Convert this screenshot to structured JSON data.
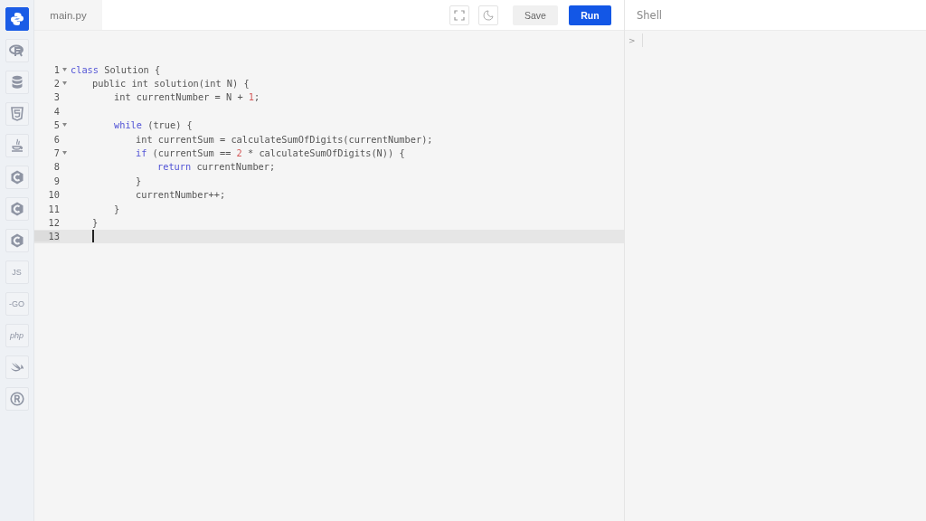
{
  "sidebar": {
    "items": [
      {
        "kind": "python",
        "selected": true
      },
      {
        "kind": "r",
        "selected": false
      },
      {
        "kind": "database",
        "selected": false
      },
      {
        "kind": "html",
        "selected": false
      },
      {
        "kind": "java",
        "selected": false
      },
      {
        "kind": "c",
        "selected": false
      },
      {
        "kind": "c",
        "selected": false
      },
      {
        "kind": "c",
        "selected": false
      },
      {
        "kind": "text",
        "label": "JS",
        "selected": false
      },
      {
        "kind": "text",
        "label": "-GO",
        "selected": false
      },
      {
        "kind": "text",
        "label": "php",
        "italic": true,
        "selected": false
      },
      {
        "kind": "swift",
        "selected": false
      },
      {
        "kind": "registered",
        "selected": false
      }
    ]
  },
  "editor": {
    "tab": "main.py",
    "buttons": {
      "save": "Save",
      "run": "Run"
    },
    "lines": [
      {
        "number": "1",
        "foldable": true,
        "active": false,
        "tokens": [
          {
            "kind": "keyword",
            "text": "class"
          },
          {
            "kind": "plain",
            "text": " Solution {"
          }
        ]
      },
      {
        "number": "2",
        "foldable": true,
        "active": false,
        "tokens": [
          {
            "kind": "plain",
            "text": "public int solution(int N) {"
          }
        ]
      },
      {
        "number": "3",
        "foldable": false,
        "active": false,
        "tokens": [
          {
            "kind": "plain",
            "text": "int currentNumber = N + "
          },
          {
            "kind": "number",
            "text": "1"
          },
          {
            "kind": "plain",
            "text": ";"
          }
        ]
      },
      {
        "number": "4",
        "foldable": false,
        "active": false
      },
      {
        "number": "5",
        "foldable": true,
        "active": false,
        "tokens": [
          {
            "kind": "keyword",
            "text": "while"
          },
          {
            "kind": "plain",
            "text": " (true) {"
          }
        ]
      },
      {
        "number": "6",
        "foldable": false,
        "active": false,
        "tokens": [
          {
            "kind": "plain",
            "text": "int currentSum = calculateSumOfDigits(currentNumber);"
          }
        ]
      },
      {
        "number": "7",
        "foldable": true,
        "active": false,
        "tokens": [
          {
            "kind": "keyword",
            "text": "if"
          },
          {
            "kind": "plain",
            "text": " (currentSum == "
          },
          {
            "kind": "number",
            "text": "2"
          },
          {
            "kind": "plain",
            "text": " * calculateSumOfDigits(N)) {"
          }
        ]
      },
      {
        "number": "8",
        "foldable": false,
        "active": false,
        "tokens": [
          {
            "kind": "keyword",
            "text": "return"
          },
          {
            "kind": "plain",
            "text": " currentNumber;"
          }
        ]
      },
      {
        "number": "9",
        "foldable": false,
        "active": false,
        "tokens": [
          {
            "kind": "plain",
            "text": "}"
          }
        ]
      },
      {
        "number": "10",
        "foldable": false,
        "active": false,
        "tokens": [
          {
            "kind": "plain",
            "text": "currentNumber++;"
          }
        ]
      },
      {
        "number": "11",
        "foldable": false,
        "active": false,
        "tokens": [
          {
            "kind": "plain",
            "text": "}"
          }
        ]
      },
      {
        "number": "12",
        "foldable": false,
        "active": false,
        "tokens": [
          {
            "kind": "plain",
            "text": "}"
          }
        ]
      },
      {
        "number": "13",
        "foldable": false,
        "active": true
      }
    ]
  },
  "shell": {
    "title": "Shell",
    "prompt": ">"
  }
}
